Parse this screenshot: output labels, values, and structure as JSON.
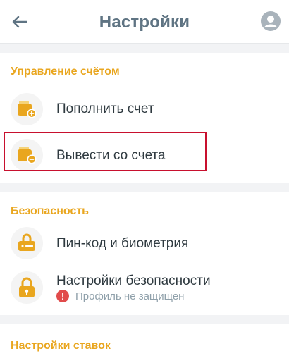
{
  "header": {
    "title": "Настройки",
    "back_icon": "arrow-left-icon",
    "avatar_icon": "user-avatar-icon"
  },
  "account_section": {
    "title": "Управление счётом",
    "items": [
      {
        "label": "Пополнить счет",
        "icon": "wallet-plus-icon"
      },
      {
        "label": "Вывести со счета",
        "icon": "wallet-minus-icon"
      }
    ]
  },
  "security_section": {
    "title": "Безопасность",
    "items": [
      {
        "label": "Пин-код и биометрия",
        "icon": "lock-pin-icon"
      },
      {
        "label": "Настройки безопасности",
        "icon": "padlock-open-icon",
        "status": "Профиль не защищен",
        "status_icon": "exclamation-icon"
      }
    ]
  },
  "bets_section": {
    "title": "Настройки ставок"
  },
  "colors": {
    "accent": "#e9a61f",
    "title": "#5f7483",
    "icon_bg": "#f4f4f4",
    "warning": "#e14b4b",
    "highlight": "#c8102e"
  }
}
